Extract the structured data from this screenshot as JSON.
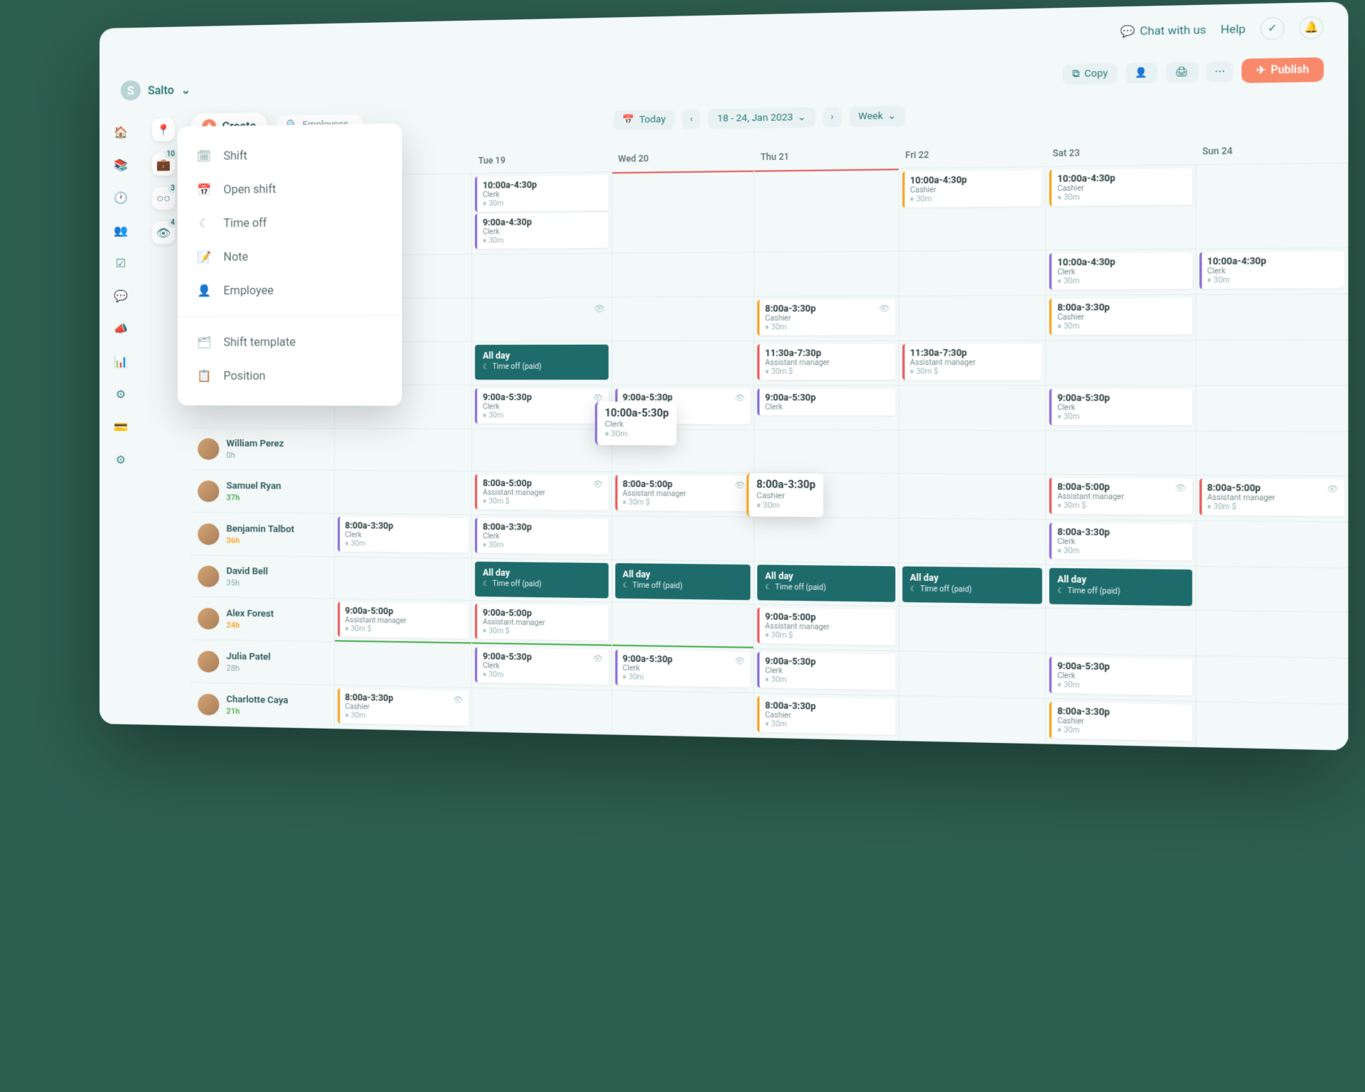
{
  "topbar": {
    "chat": "Chat with us",
    "help": "Help"
  },
  "brand": "Salto",
  "toolbar": {
    "copy": "Copy",
    "publish": "Publish"
  },
  "controls": {
    "today": "Today",
    "date_range": "18 - 24, Jan 2023",
    "view": "Week"
  },
  "create": {
    "label": "Create",
    "search_placeholder": "Employees",
    "items": {
      "shift": "Shift",
      "open_shift": "Open shift",
      "time_off": "Time off",
      "note": "Note",
      "employee": "Employee",
      "shift_template": "Shift template",
      "position": "Position"
    }
  },
  "panel_badges": {
    "b1": "10",
    "b2": "3",
    "b3": "4"
  },
  "days": {
    "tue": "Tue 19",
    "wed": "Wed 20",
    "thu": "Thu 21",
    "fri": "Fri 22",
    "sat": "Sat 23",
    "sun": "Sun 24"
  },
  "labels": {
    "allday": "All day",
    "timeoff_paid": "Time off (paid)",
    "break30": "30m",
    "break30d": "30m $"
  },
  "roles": {
    "clerk": "Clerk",
    "cashier": "Cashier",
    "am": "Assistant manager"
  },
  "times": {
    "t10_430": "10:00a-4:30p",
    "t9_430": "9:00a-4:30p",
    "t8_330": "8:00a-3:30p",
    "t1130_730": "11:30a-7:30p",
    "t9_530": "9:00a-5:30p",
    "t10_530": "10:00a-5:30p",
    "t8_500": "8:00a-5:00p",
    "t9_500": "9:00a-5:00p"
  },
  "employees": {
    "e1": {
      "name": "William Perez",
      "hours": "0h"
    },
    "e2": {
      "name": "Samuel Ryan",
      "hours": "37h"
    },
    "e3": {
      "name": "Benjamin Talbot",
      "hours": "36h"
    },
    "e4": {
      "name": "David Bell",
      "hours": "35h"
    },
    "e5": {
      "name": "Alex Forest",
      "hours": "24h"
    },
    "e6": {
      "name": "Julia Patel",
      "hours": "28h"
    },
    "e7": {
      "name": "Charlotte Caya",
      "hours": "21h"
    }
  },
  "float1": {
    "time": "10:00a-5:30p",
    "role": "Clerk",
    "break": "30m"
  },
  "float2": {
    "time": "8:00a-3:30p",
    "role": "Cashier",
    "break": "30m"
  }
}
